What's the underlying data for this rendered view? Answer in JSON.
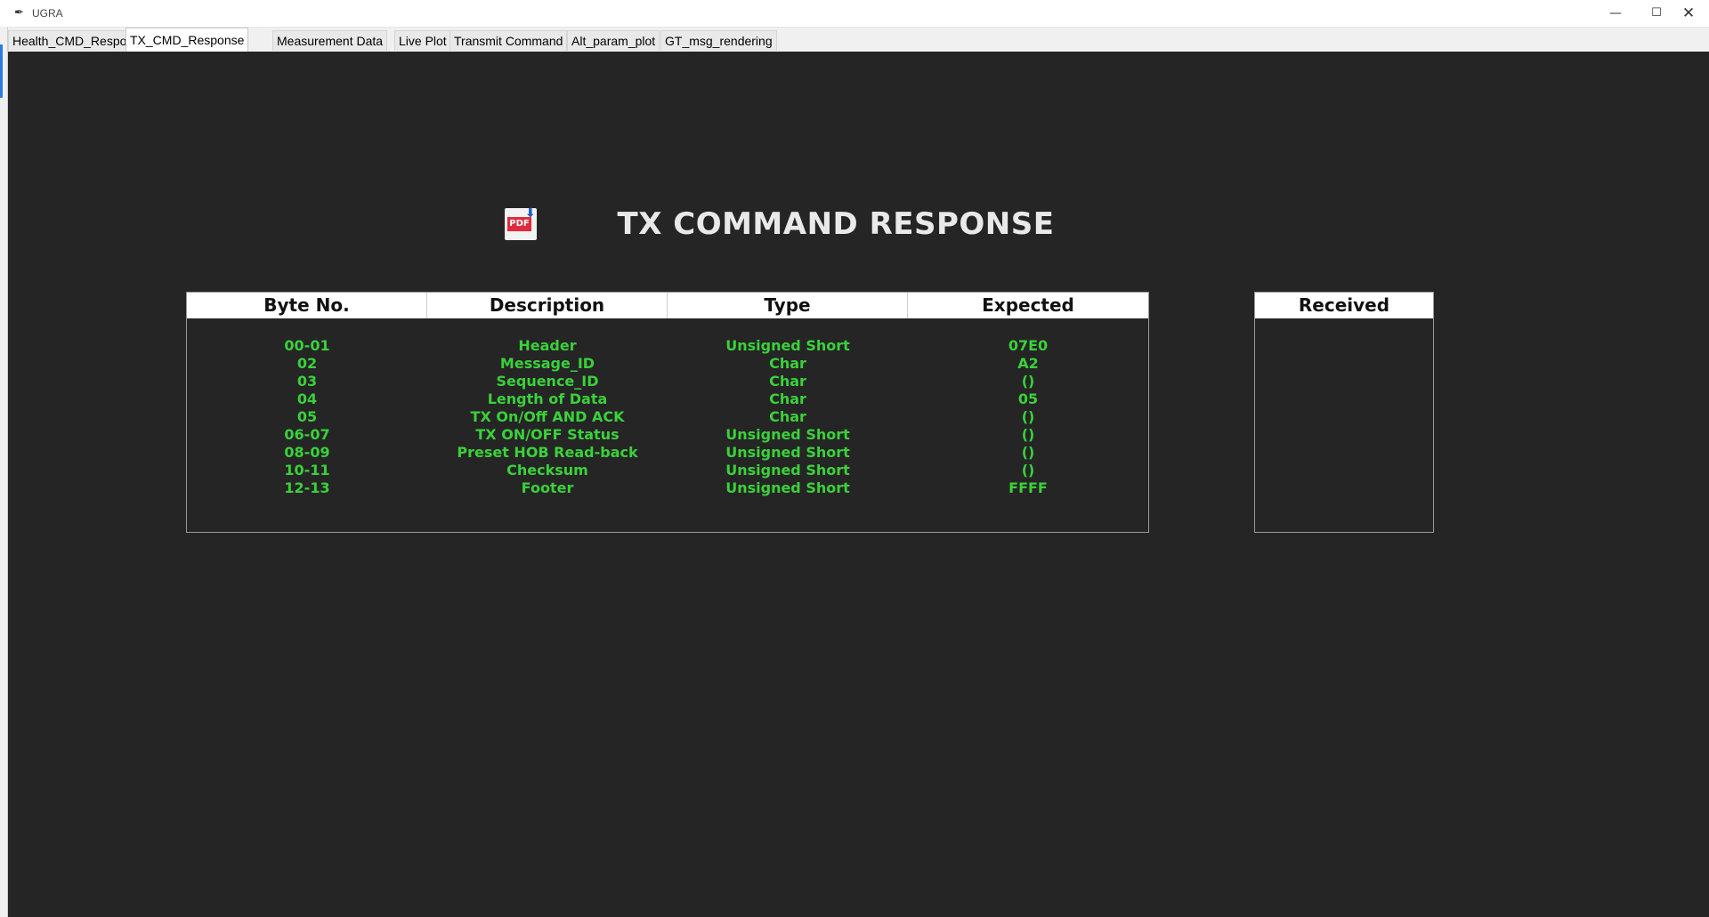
{
  "window": {
    "title": "UGRA",
    "app_icon": "feather-icon",
    "controls": {
      "minimize": "—",
      "maximize": "☐",
      "close": "✕"
    }
  },
  "tabs": [
    {
      "label": "Health_CMD_Response",
      "active": false
    },
    {
      "label": "TX_CMD_Response",
      "active": true
    },
    {
      "label": "Measurement Data",
      "active": false
    },
    {
      "label": "Live Plot",
      "active": false
    },
    {
      "label": "Transmit Command",
      "active": false
    },
    {
      "label": "Alt_param_plot",
      "active": false
    },
    {
      "label": "GT_msg_rendering",
      "active": false
    }
  ],
  "page": {
    "title": "TX COMMAND RESPONSE",
    "pdf_icon": {
      "name": "pdf-download-icon",
      "label": "PDF"
    }
  },
  "table": {
    "headers": [
      "Byte No.",
      "Description",
      "Type",
      "Expected"
    ],
    "rows": [
      [
        "00-01",
        "Header",
        "Unsigned Short",
        "07E0"
      ],
      [
        "02",
        "Message_ID",
        "Char",
        "A2"
      ],
      [
        "03",
        "Sequence_ID",
        "Char",
        "()"
      ],
      [
        "04",
        "Length of Data",
        "Char",
        "05"
      ],
      [
        "05",
        "TX On/Off AND ACK",
        "Char",
        "()"
      ],
      [
        "06-07",
        "TX ON/OFF Status",
        "Unsigned Short",
        "()"
      ],
      [
        "08-09",
        "Preset HOB Read-back",
        "Unsigned Short",
        "()"
      ],
      [
        "10-11",
        "Checksum",
        "Unsigned Short",
        "()"
      ],
      [
        "12-13",
        "Footer",
        "Unsigned Short",
        "FFFF"
      ]
    ]
  },
  "received": {
    "header": "Received"
  },
  "colors": {
    "background": "#252525",
    "value_text": "#3ad13a",
    "title_text": "#e9e9e9",
    "header_bg": "#ffffff"
  }
}
